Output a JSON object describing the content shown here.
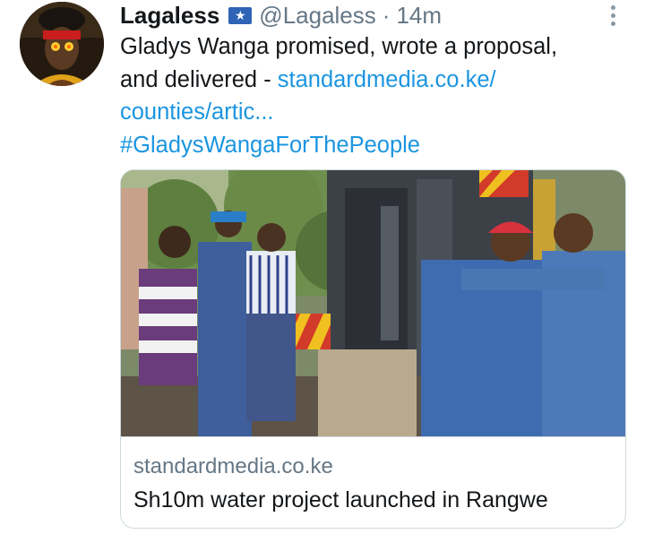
{
  "tweet": {
    "display_name": "Lagaless",
    "flag_icon": "somalia-flag-icon",
    "flag_glyph": "★",
    "handle": "@Lagaless",
    "separator": "·",
    "time": "14m",
    "text_lines": [
      "Gladys Wanga promised, wrote a proposal,",
      "and delivered - "
    ],
    "link_part1": "standardmedia.co.ke/",
    "link_part2": "counties/artic...",
    "hashtag": "#GladysWangaForThePeople"
  },
  "card": {
    "image_icon": "water-drilling-photo",
    "domain": "standardmedia.co.ke",
    "title": "Sh10m water project launched in Rangwe"
  },
  "colors": {
    "link": "#1b95e0",
    "muted": "#657786",
    "text": "#14171a"
  }
}
